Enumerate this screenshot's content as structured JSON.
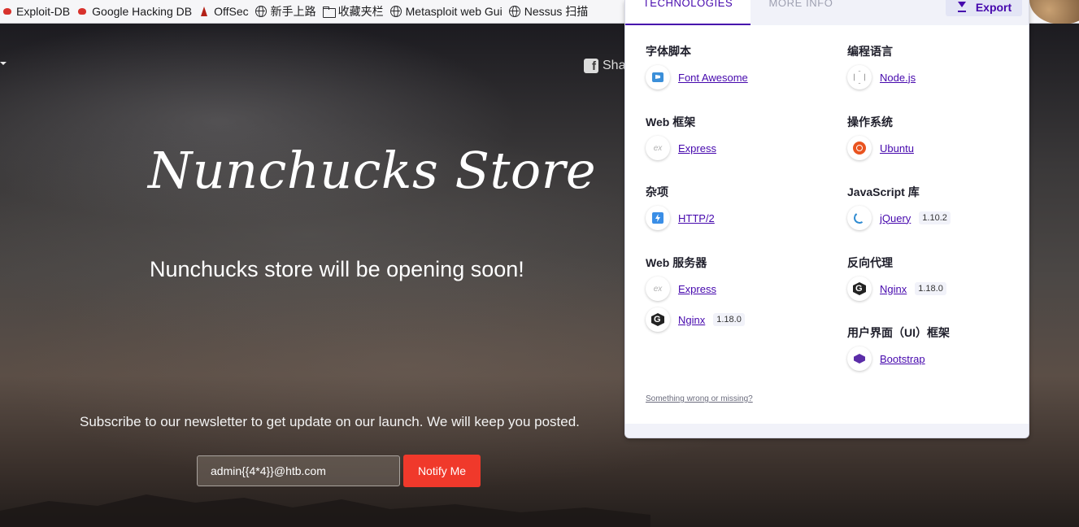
{
  "bookmarks": [
    {
      "label": "Exploit-DB",
      "icon": "exploit-db-icon"
    },
    {
      "label": "Google Hacking DB",
      "icon": "ghdb-icon"
    },
    {
      "label": "OffSec",
      "icon": "offsec-icon"
    },
    {
      "label": "新手上路",
      "icon": "globe-icon"
    },
    {
      "label": "收藏夹栏",
      "icon": "folder-icon"
    },
    {
      "label": "Metasploit web Gui",
      "icon": "globe-icon"
    },
    {
      "label": "Nessus 扫描",
      "icon": "globe-icon"
    }
  ],
  "site": {
    "share_label": "Sha",
    "title": "Nunchucks Store",
    "subtitle": "Nunchucks store will be opening soon!",
    "subscribe_text": "Subscribe to our newsletter to get update on our launch. We will keep you posted.",
    "email_value": "admin{{4*4}}@htb.com",
    "notify_label": "Notify Me"
  },
  "popup": {
    "tabs": {
      "technologies": "TECHNOLOGIES",
      "more_info": "MORE INFO"
    },
    "export_label": "Export",
    "feedback_link": "Something wrong or missing?",
    "left_column": [
      {
        "category": "字体脚本",
        "items": [
          {
            "name": "Font Awesome",
            "version": "",
            "icon": "font-awesome-icon"
          }
        ]
      },
      {
        "category": "Web 框架",
        "items": [
          {
            "name": "Express",
            "version": "",
            "icon": "express-icon"
          }
        ]
      },
      {
        "category": "杂项",
        "items": [
          {
            "name": "HTTP/2",
            "version": "",
            "icon": "http2-icon"
          }
        ]
      },
      {
        "category": "Web 服务器",
        "items": [
          {
            "name": "Express",
            "version": "",
            "icon": "express-icon"
          },
          {
            "name": "Nginx",
            "version": "1.18.0",
            "icon": "nginx-icon"
          }
        ]
      }
    ],
    "right_column": [
      {
        "category": "编程语言",
        "items": [
          {
            "name": "Node.js",
            "version": "",
            "icon": "nodejs-icon"
          }
        ]
      },
      {
        "category": "操作系统",
        "items": [
          {
            "name": "Ubuntu",
            "version": "",
            "icon": "ubuntu-icon"
          }
        ]
      },
      {
        "category": "JavaScript 库",
        "items": [
          {
            "name": "jQuery",
            "version": "1.10.2",
            "icon": "jquery-icon"
          }
        ]
      },
      {
        "category": "反向代理",
        "items": [
          {
            "name": "Nginx",
            "version": "1.18.0",
            "icon": "nginx-icon"
          }
        ]
      },
      {
        "category": "用户界面（UI）框架",
        "items": [
          {
            "name": "Bootstrap",
            "version": "",
            "icon": "bootstrap-icon"
          }
        ]
      }
    ]
  },
  "colors": {
    "accent": "#4608ad",
    "notify_button": "#f0392b"
  }
}
